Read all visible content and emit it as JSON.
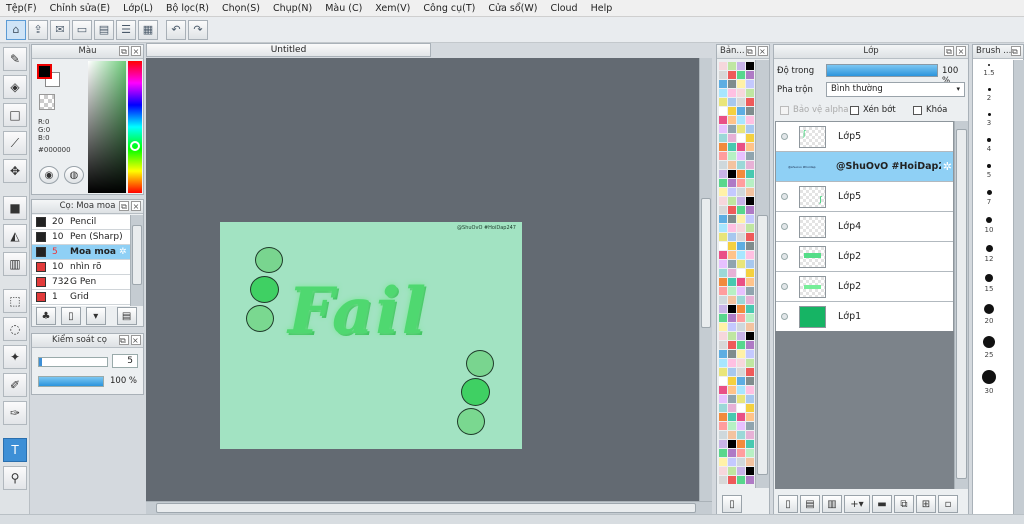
{
  "menu": [
    "Tệp(F)",
    "Chỉnh sửa(E)",
    "Lớp(L)",
    "Bộ lọc(R)",
    "Chọn(S)",
    "Chụp(N)",
    "Màu (C)",
    "Xem(V)",
    "Công cụ(T)",
    "Cửa sổ(W)",
    "Cloud",
    "Help"
  ],
  "document": {
    "tab_title": "Untitled",
    "watermark": "@ShuOvO #HoiDap247",
    "art_text": "Fail"
  },
  "color_panel": {
    "title": "Màu",
    "r": "R:0",
    "g": "G:0",
    "b": "B:0",
    "hex": "#000000"
  },
  "brush_panel": {
    "title": "Cọ: Moa moa",
    "items": [
      {
        "size": "20",
        "name": "Pencil",
        "color": "#222222"
      },
      {
        "size": "10",
        "name": "Pen (Sharp)",
        "color": "#222222"
      },
      {
        "size": "5",
        "name": "Moa moa",
        "color": "#222222",
        "selected": true
      },
      {
        "size": "10",
        "name": "nhìn rõ",
        "color": "#e23b3b"
      },
      {
        "size": "732",
        "name": "G Pen",
        "color": "#e23b3b"
      },
      {
        "size": "1",
        "name": "Grid",
        "color": "#e23b3b"
      }
    ]
  },
  "brush_control": {
    "title": "Kiểm soát cọ",
    "size": "5",
    "opacity": "100 %",
    "opacity_fraction": 1.0
  },
  "palette_panel": {
    "title": "Bản..."
  },
  "layer_panel": {
    "title": "Lớp",
    "opacity_label": "Độ trong",
    "opacity_value": "100 %",
    "opacity_fraction": 1.0,
    "blend_label": "Pha trộn",
    "blend_value": "Bình thường",
    "protect_alpha": "Bảo vệ alpha",
    "clipping": "Xén bớt",
    "lock": "Khóa",
    "layers": [
      {
        "name": "Lớp5"
      },
      {
        "name": "@ShuOvO #HoiDap247",
        "selected": true
      },
      {
        "name": "Lớp5"
      },
      {
        "name": "Lớp4"
      },
      {
        "name": "Lớp2"
      },
      {
        "name": "Lớp2"
      },
      {
        "name": "Lớp1",
        "fill": "#16b464"
      }
    ]
  },
  "brush_sizes_panel": {
    "title": "Brush ...",
    "labels": [
      "1.5",
      "2",
      "3",
      "4",
      "5",
      "7",
      "10",
      "12",
      "15",
      "20",
      "25",
      "30"
    ]
  },
  "colors": {
    "accent": "#3d8fd6",
    "canvas_bg": "#636a72",
    "paper": "#a2e3c2",
    "selection": "#8fd0f5"
  }
}
